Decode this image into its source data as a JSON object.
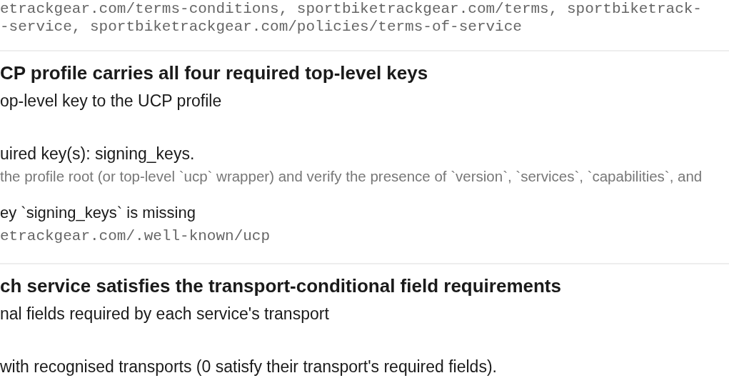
{
  "previous_check": {
    "evidence_lines": [
      "etrackgear.com/terms-conditions, sportbiketrackgear.com/terms, sportbiketrack-",
      "-service, sportbiketrackgear.com/policies/terms-of-service"
    ]
  },
  "checks": [
    {
      "title": "CP profile carries all four required top-level keys",
      "description": "op-level key to the UCP profile",
      "result": "uired key(s): signing_keys.",
      "method": " the profile root (or top-level `ucp` wrapper) and verify the presence of `version`, `services`, `capabilities`, and",
      "finding": "ey `signing_keys` is missing",
      "source": "etrackgear.com/.well-known/ucp"
    },
    {
      "title": "ch service satisfies the transport-conditional field requirements",
      "description": "nal fields required by each service's transport",
      "result": "with recognised transports (0 satisfy their transport's required fields)."
    }
  ]
}
